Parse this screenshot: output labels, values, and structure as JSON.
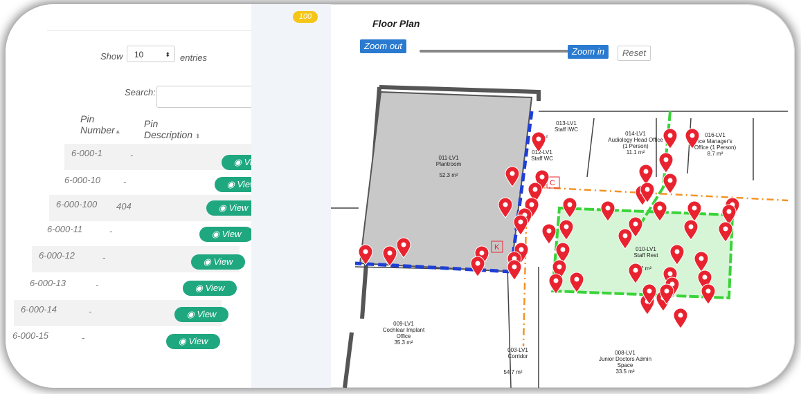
{
  "badge": "100",
  "table": {
    "show_label": "Show",
    "entries_value": "10",
    "entries_label": "entries",
    "search_label": "Search:",
    "col_pin_number": [
      "Pin",
      "Number"
    ],
    "col_pin_description": [
      "Pin",
      "Description"
    ],
    "rows": [
      {
        "number": "6-000-1",
        "description": "-",
        "action": "View"
      },
      {
        "number": "6-000-10",
        "description": "-",
        "action": "View"
      },
      {
        "number": "6-000-100",
        "description": "404",
        "action": "View"
      },
      {
        "number": "6-000-11",
        "description": "-",
        "action": "View"
      },
      {
        "number": "6-000-12",
        "description": "-",
        "action": "View"
      },
      {
        "number": "6-000-13",
        "description": "-",
        "action": "View"
      },
      {
        "number": "6-000-14",
        "description": "-",
        "action": "View"
      },
      {
        "number": "6-000-15",
        "description": "-",
        "action": "View"
      }
    ]
  },
  "floorplan": {
    "title": "Floor Plan",
    "zoom_out": "Zoom out",
    "zoom_in": "Zoom in",
    "reset": "Reset",
    "rooms": [
      {
        "code": "013-LV1",
        "name": "Staff IWC",
        "area": "3 m²"
      },
      {
        "code": "014-LV1",
        "name": "Audiology Head Office",
        "sub": "(1 Person)",
        "area": "11.1 m²"
      },
      {
        "code": "016-LV1",
        "name": "ice Manager's",
        "sub": "Office (1 Person)",
        "area": "8.7 m²"
      },
      {
        "code": "011-LV1",
        "name": "Plantroom",
        "area": "52.3 m²"
      },
      {
        "code": "012-LV1",
        "name": "Staff WC",
        "area": ""
      },
      {
        "code": "010-LV1",
        "name": "Staff Rest",
        "area": "2 m²"
      },
      {
        "code": "009-LV1",
        "name": "Cochlear Implant",
        "sub": "Office",
        "area": "35.3 m²"
      },
      {
        "code": "003-LV1",
        "name": "Corridor",
        "area": "54.7 m²"
      },
      {
        "code": "008-LV1",
        "name": "Junior Doctors Admin",
        "sub": "Space",
        "area": "33.5 m²"
      }
    ],
    "markers": [
      "C",
      "K"
    ],
    "colors": {
      "pin": "#e8232f",
      "blue_dash": "#1f3fd6",
      "green": "#39d339",
      "orange": "#f39323",
      "plant_fill": "#c8c8c8",
      "btn_blue": "#2a7bd0",
      "view_green": "#1fa77f",
      "badge": "#f5c518"
    }
  }
}
